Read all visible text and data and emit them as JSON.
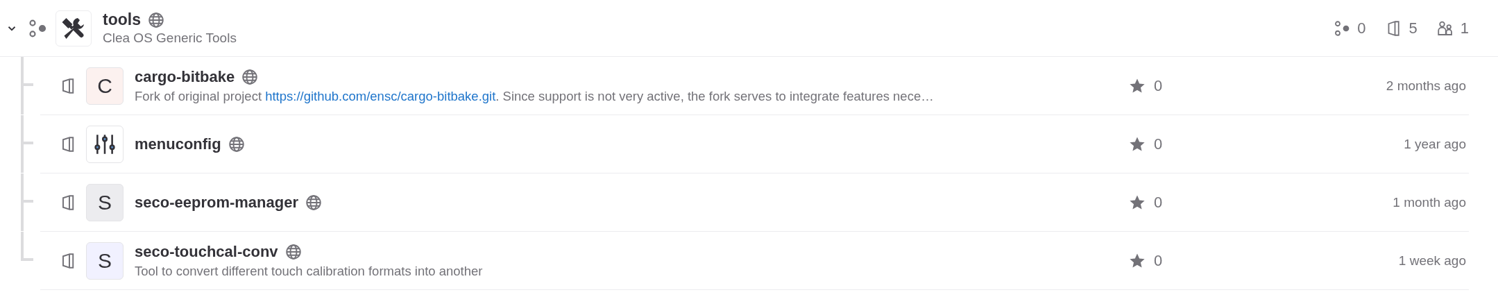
{
  "group": {
    "name": "tools",
    "description": "Clea OS Generic Tools",
    "expanded": true,
    "public": true,
    "stats": [
      {
        "kind": "subgroups",
        "value": "0"
      },
      {
        "kind": "projects",
        "value": "5"
      },
      {
        "kind": "members",
        "value": "1"
      }
    ]
  },
  "projects": [
    {
      "name": "cargo-bitbake",
      "public": true,
      "avatar": {
        "kind": "letter",
        "letter": "C",
        "color": "#fcf1ef"
      },
      "description": [
        {
          "kind": "text",
          "text": "Fork of original project "
        },
        {
          "kind": "link",
          "text": "https://github.com/ensc/cargo-bitbake.git"
        },
        {
          "kind": "text",
          "text": ". Since support is not very active, the fork serves to integrate features nece…"
        }
      ],
      "stars": "0",
      "updated": "2 months ago"
    },
    {
      "name": "menuconfig",
      "public": true,
      "avatar": {
        "kind": "icon"
      },
      "stars": "0",
      "updated": "1 year ago"
    },
    {
      "name": "seco-eeprom-manager",
      "public": true,
      "avatar": {
        "kind": "letter",
        "letter": "S",
        "color": "#ececef"
      },
      "stars": "0",
      "updated": "1 month ago"
    },
    {
      "name": "seco-touchcal-conv",
      "public": true,
      "avatar": {
        "kind": "letter",
        "letter": "S",
        "color": "#f1f1ff"
      },
      "description": [
        {
          "kind": "text",
          "text": "Tool to convert different touch calibration formats into another"
        }
      ],
      "stars": "0",
      "updated": "1 week ago"
    }
  ]
}
